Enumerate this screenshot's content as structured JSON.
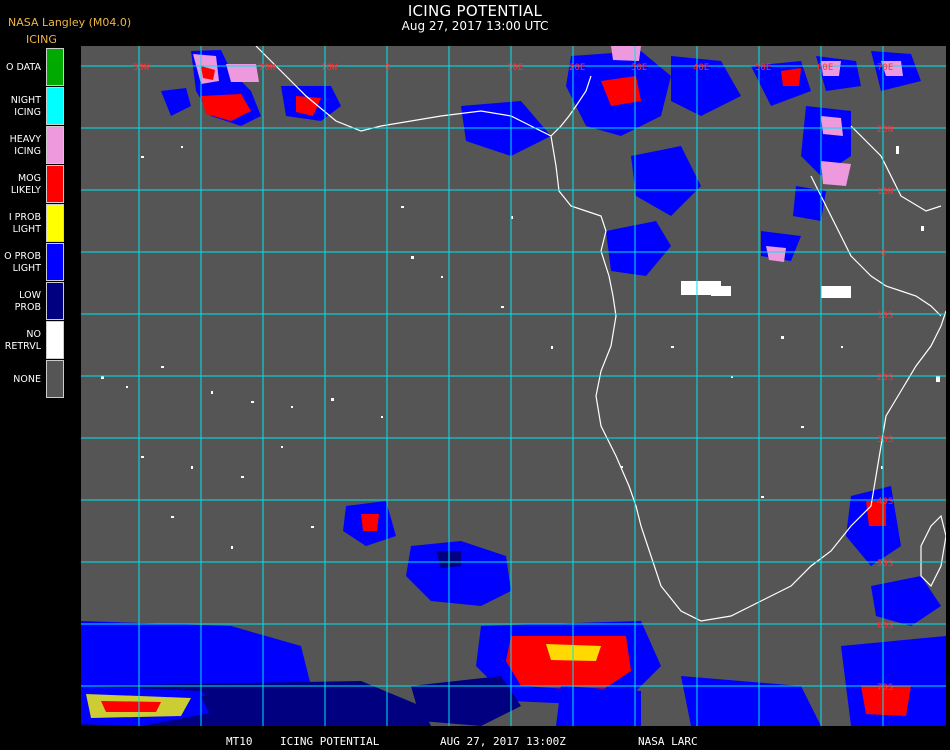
{
  "header": {
    "agency": "NASA Langley (M04.0)",
    "product": "ICING",
    "title": "ICING POTENTIAL",
    "subtitle": "Aug 27, 2017 13:00 UTC"
  },
  "legend": {
    "items": [
      {
        "label_lines": [
          "O DATA"
        ],
        "color": "#00aa00"
      },
      {
        "label_lines": [
          "NIGHT",
          "ICING"
        ],
        "color": "#00ffff"
      },
      {
        "label_lines": [
          "HEAVY",
          "ICING"
        ],
        "color": "#ee99dd"
      },
      {
        "label_lines": [
          "MOG",
          "LIKELY"
        ],
        "color": "#ff0000"
      },
      {
        "label_lines": [
          "I PROB",
          "LIGHT"
        ],
        "color": "#ffff00"
      },
      {
        "label_lines": [
          "O PROB",
          "LIGHT"
        ],
        "color": "#0000ff"
      },
      {
        "label_lines": [
          "LOW",
          "PROB"
        ],
        "color": "#000080"
      },
      {
        "label_lines": [
          "NO",
          "RETRVL"
        ],
        "color": "#ffffff"
      },
      {
        "label_lines": [
          "NONE"
        ],
        "color": "#555555"
      }
    ]
  },
  "map": {
    "background_color": "#555555",
    "grid_color": "#00e5ee",
    "coast_color": "#ffffff",
    "label_color": "#ff3030",
    "top_labels": [
      "30W",
      "20W",
      "10W",
      "0",
      "10E",
      "20E",
      "30E",
      "40E",
      "50E",
      "60E",
      "70E"
    ],
    "right_labels": [
      "20N",
      "10N",
      "0",
      "10S",
      "20S",
      "30S",
      "40S",
      "50S",
      "60S",
      "70S"
    ]
  },
  "footer": {
    "id": "MT10",
    "product": "ICING POTENTIAL",
    "datetime": "AUG 27, 2017 13:00Z",
    "source": "NASA LARC"
  }
}
